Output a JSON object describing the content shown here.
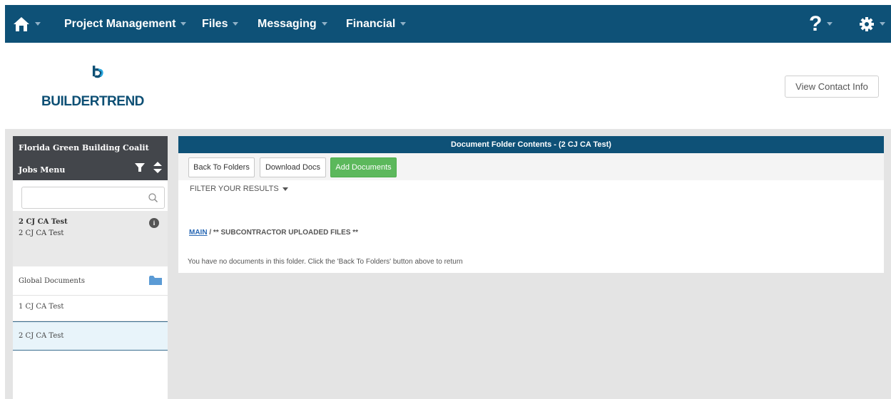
{
  "nav": {
    "items": [
      {
        "label": "Project Management"
      },
      {
        "label": "Files"
      },
      {
        "label": "Messaging"
      },
      {
        "label": "Financial"
      }
    ],
    "help_label": "?"
  },
  "header": {
    "logo_text": "BUILDERTREND",
    "contact_button": "View Contact Info"
  },
  "sidebar": {
    "company": "Florida Green Building Coalit",
    "menu_title": "Jobs Menu",
    "search_placeholder": "",
    "selected_job": {
      "name": "2 CJ CA Test",
      "subtitle": "2 CJ CA Test"
    },
    "items": [
      {
        "label": "Global Documents"
      },
      {
        "label": "1 CJ CA Test"
      },
      {
        "label": "2 CJ CA Test"
      }
    ]
  },
  "panel": {
    "title": "Document Folder Contents - (2 CJ CA Test)",
    "buttons": {
      "back": "Back To Folders",
      "download": "Download Docs",
      "add": "Add Documents"
    },
    "filter_label": "FILTER YOUR RESULTS",
    "breadcrumb": {
      "root": "MAIN",
      "separator": " / ",
      "current": "** SUBCONTRACTOR UPLOADED FILES **"
    },
    "empty_message": "You have no documents in this folder. Click the 'Back To Folders' button above to return"
  },
  "colors": {
    "nav_bg": "#0e5177",
    "accent_green": "#5cb85c",
    "sidebar_head": "#43464b",
    "workspace_bg": "#e4e4e4"
  }
}
